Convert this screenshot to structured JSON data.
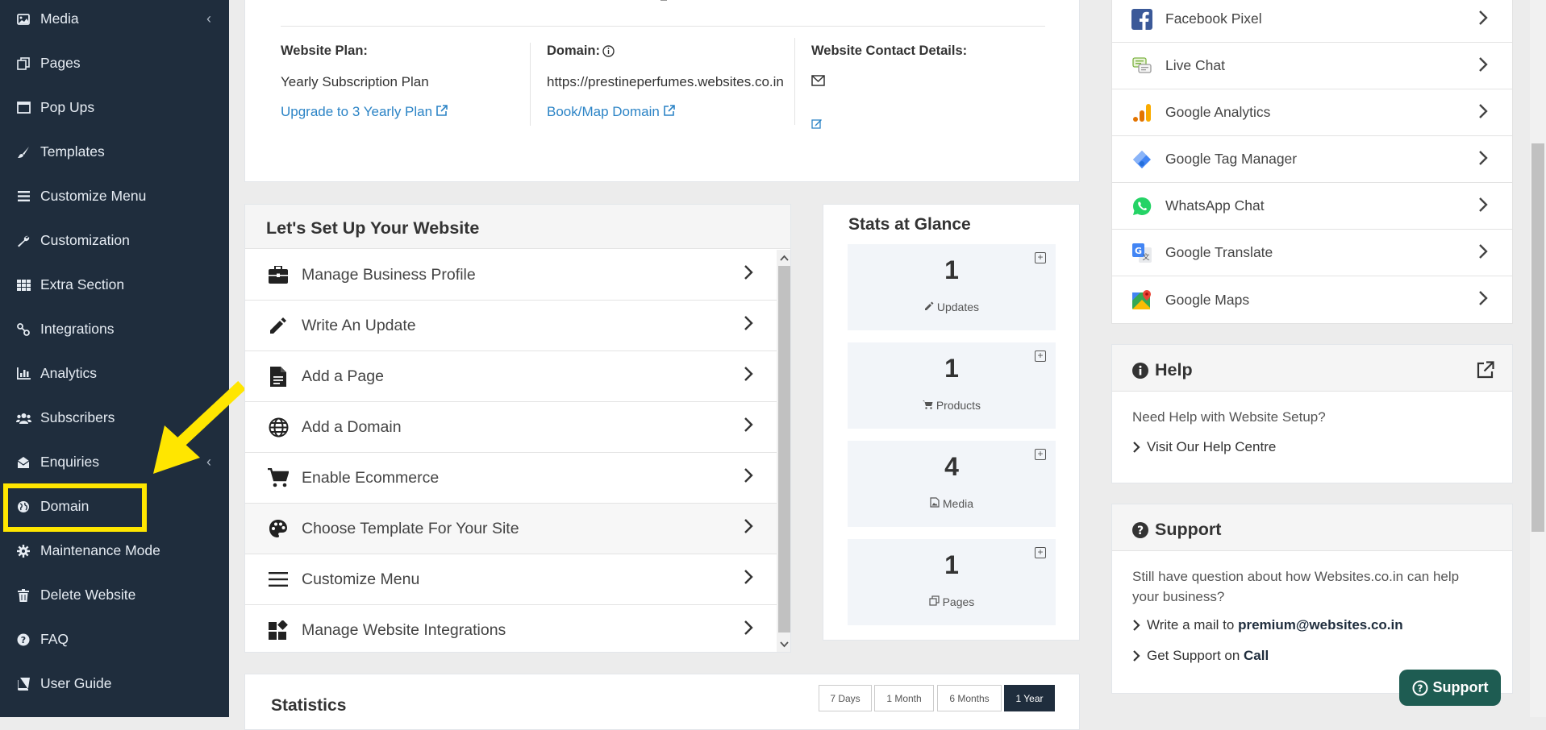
{
  "sidebar": {
    "items": [
      {
        "label": "Media",
        "icon": "image-icon",
        "has_chevron": true
      },
      {
        "label": "Pages",
        "icon": "copy-icon"
      },
      {
        "label": "Pop Ups",
        "icon": "window-icon"
      },
      {
        "label": "Templates",
        "icon": "paint-brush-icon"
      },
      {
        "label": "Customize Menu",
        "icon": "bars-icon"
      },
      {
        "label": "Customization",
        "icon": "wrench-icon"
      },
      {
        "label": "Extra Section",
        "icon": "grid-icon"
      },
      {
        "label": "Integrations",
        "icon": "plug-icon"
      },
      {
        "label": "Analytics",
        "icon": "bar-chart-icon"
      },
      {
        "label": "Subscribers",
        "icon": "users-icon"
      },
      {
        "label": "Enquiries",
        "icon": "envelope-open-icon",
        "has_chevron": true
      },
      {
        "label": "Domain",
        "icon": "globe-icon",
        "highlighted": true
      },
      {
        "label": "Maintenance Mode",
        "icon": "gear-icon"
      },
      {
        "label": "Delete Website",
        "icon": "trash-icon"
      },
      {
        "label": "FAQ",
        "icon": "question-circle-icon"
      },
      {
        "label": "User Guide",
        "icon": "book-icon"
      }
    ]
  },
  "info": {
    "plan_label": "Website Plan:",
    "plan_value": "Yearly Subscription Plan",
    "plan_link": "Upgrade to 3 Yearly Plan",
    "domain_label": "Domain:",
    "domain_value": "https://prestineperfumes.websites.co.in",
    "domain_link": "Book/Map Domain",
    "contact_label": "Website Contact Details:"
  },
  "setup": {
    "title": "Let's Set Up Your Website",
    "items": [
      {
        "label": "Manage Business Profile",
        "icon": "briefcase-icon"
      },
      {
        "label": "Write An Update",
        "icon": "pencil-icon"
      },
      {
        "label": "Add a Page",
        "icon": "file-icon"
      },
      {
        "label": "Add a Domain",
        "icon": "globe-icon"
      },
      {
        "label": "Enable Ecommerce",
        "icon": "cart-icon"
      },
      {
        "label": "Choose Template For Your Site",
        "icon": "palette-icon"
      },
      {
        "label": "Customize Menu",
        "icon": "bars-icon"
      },
      {
        "label": "Manage Website Integrations",
        "icon": "widgets-icon"
      }
    ]
  },
  "stats": {
    "title": "Stats at Glance",
    "items": [
      {
        "value": "1",
        "label": "Updates",
        "icon": "pencil-icon"
      },
      {
        "value": "1",
        "label": "Products",
        "icon": "cart-icon"
      },
      {
        "value": "4",
        "label": "Media",
        "icon": "image-icon"
      },
      {
        "value": "1",
        "label": "Pages",
        "icon": "copy-icon"
      }
    ]
  },
  "integrations": {
    "items": [
      {
        "label": "Facebook Pixel",
        "icon": "facebook-icon"
      },
      {
        "label": "Live Chat",
        "icon": "chat-icon"
      },
      {
        "label": "Google Analytics",
        "icon": "google-analytics-icon"
      },
      {
        "label": "Google Tag Manager",
        "icon": "tag-manager-icon"
      },
      {
        "label": "WhatsApp Chat",
        "icon": "whatsapp-icon"
      },
      {
        "label": "Google Translate",
        "icon": "google-translate-icon"
      },
      {
        "label": "Google Maps",
        "icon": "google-maps-icon"
      }
    ]
  },
  "help": {
    "title": "Help",
    "text": "Need Help with Website Setup?",
    "link": "Visit Our Help Centre"
  },
  "support": {
    "title": "Support",
    "text": "Still have question about how Websites.co.in can help your business?",
    "mail_prefix": "Write a mail to ",
    "mail": "premium@websites.co.in",
    "call_prefix": "Get Support on ",
    "call": "Call",
    "button": "Support"
  },
  "statistics": {
    "title": "Statistics",
    "ranges": [
      "7 Days",
      "1 Month",
      "6 Months",
      "1 Year"
    ],
    "active_range": "1 Year"
  },
  "colors": {
    "sidebar_bg": "#1f2d3d",
    "highlight": "#ffe600",
    "link": "#2c84c6",
    "support_button": "#1e5c52",
    "active_range": "#1f2d3d"
  }
}
